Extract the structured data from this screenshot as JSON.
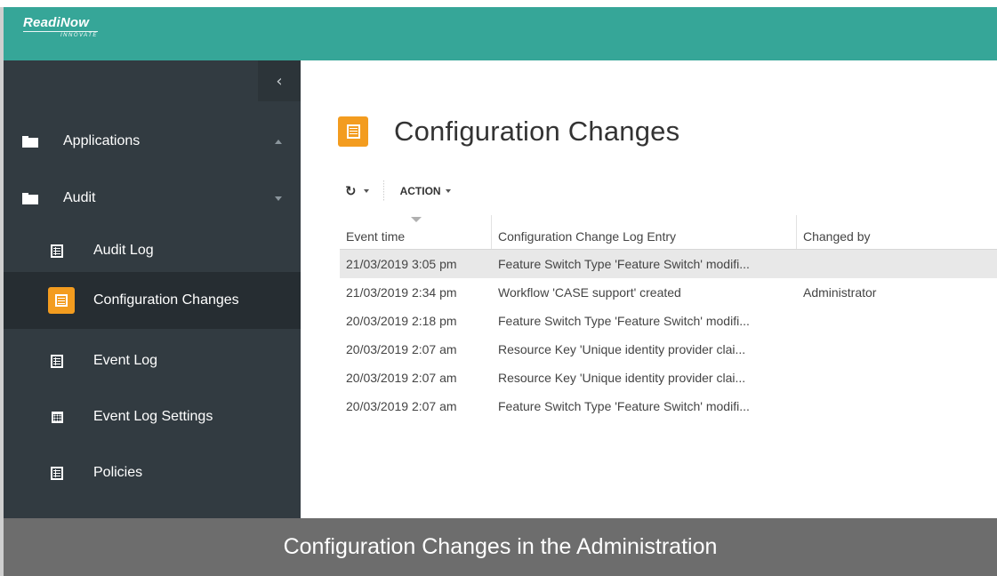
{
  "header": {
    "logo_main": "ReadiNow",
    "logo_sub": "INNOVATE",
    "accent_color": "#36a698"
  },
  "sidebar": {
    "collapse_icon": "chevron-left-icon",
    "items": [
      {
        "label": "Applications",
        "icon": "folder-icon",
        "expanded": false
      },
      {
        "label": "Audit",
        "icon": "folder-icon",
        "expanded": true
      },
      {
        "label": "Audit Log",
        "icon": "report-icon"
      },
      {
        "label": "Configuration Changes",
        "icon": "report-icon",
        "active": true
      },
      {
        "label": "Event Log",
        "icon": "report-icon"
      },
      {
        "label": "Event Log Settings",
        "icon": "calendar-icon"
      },
      {
        "label": "Policies",
        "icon": "report-icon"
      }
    ]
  },
  "main": {
    "title": "Configuration Changes",
    "title_icon": "report-icon",
    "badge_color": "#f39c1f",
    "toolbar": {
      "refresh_icon": "refresh-icon",
      "action_label": "ACTION"
    },
    "table": {
      "columns": [
        "Event time",
        "Configuration Change Log Entry",
        "Changed by"
      ],
      "sorted_column": "Event time",
      "rows": [
        {
          "time": "21/03/2019 3:05 pm",
          "entry": "Feature Switch Type 'Feature Switch' modifi...",
          "by": "",
          "selected": true
        },
        {
          "time": "21/03/2019 2:34 pm",
          "entry": "Workflow 'CASE support' created",
          "by": "Administrator"
        },
        {
          "time": "20/03/2019 2:18 pm",
          "entry": "Feature Switch Type 'Feature Switch' modifi...",
          "by": ""
        },
        {
          "time": "20/03/2019 2:07 am",
          "entry": "Resource Key 'Unique identity provider clai...",
          "by": ""
        },
        {
          "time": "20/03/2019 2:07 am",
          "entry": "Resource Key 'Unique identity provider clai...",
          "by": ""
        },
        {
          "time": "20/03/2019 2:07 am",
          "entry": "Feature Switch Type 'Feature Switch' modifi...",
          "by": ""
        }
      ]
    }
  },
  "caption": "Configuration Changes in the Administration"
}
